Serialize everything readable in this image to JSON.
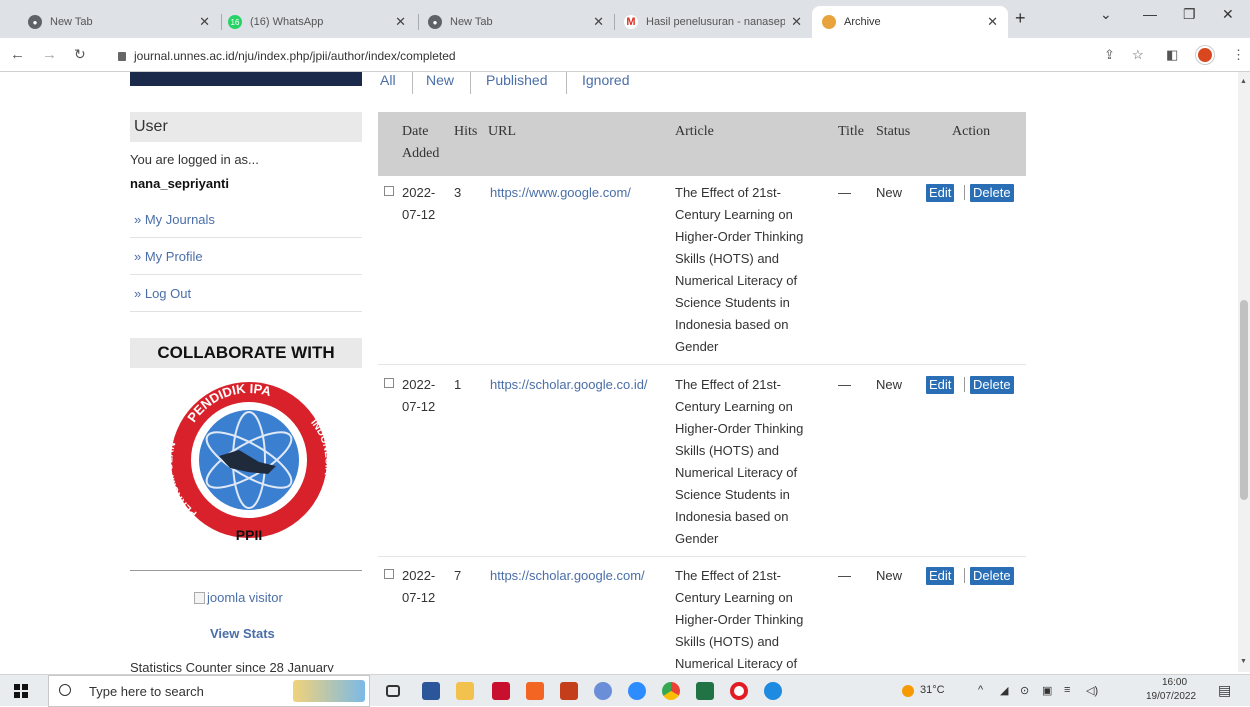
{
  "browser": {
    "tabs": [
      {
        "title": "New Tab",
        "color": "#5f6368"
      },
      {
        "title": "(16) WhatsApp",
        "color": "#25d366",
        "badge": "16"
      },
      {
        "title": "New Tab",
        "color": "#5f6368"
      },
      {
        "title": "Hasil penelusuran - nanasep",
        "color": "#d93025",
        "badge": "M"
      },
      {
        "title": "Archive",
        "color": "#e8a33d"
      }
    ],
    "url": "journal.unnes.ac.id/nju/index.php/jpii/author/index/completed"
  },
  "sidebar": {
    "user_title": "User",
    "logged_in_as": "You are logged in as...",
    "username": "nana_sepriyanti",
    "links": [
      "» My Journals",
      "» My Profile",
      "» Log Out"
    ],
    "collab_title": "COLLABORATE WITH",
    "logo_top_text": "PENDIDIK IPA",
    "logo_left_text": "PERKUMPULAN",
    "logo_right_text": "INDONESIA",
    "logo_bottom_text": "PPII",
    "visitor_img_alt": "joomla visitor",
    "view_stats": "View Stats",
    "counter_text": "Statistics Counter since 28 January"
  },
  "filters": {
    "items": [
      "All",
      "New",
      "Published",
      "Ignored"
    ]
  },
  "table": {
    "headers": {
      "date_line1": "Date",
      "date_line2": "Added",
      "hits": "Hits",
      "url": "URL",
      "article": "Article",
      "title": "Title",
      "status": "Status",
      "action": "Action"
    },
    "rows": [
      {
        "date": "2022-07-12",
        "hits": "3",
        "url": "https://www.google.com/",
        "article": "The Effect of 21st-Century Learning on Higher-Order Thinking Skills (HOTS) and Numerical Literacy of Science Students in Indonesia based on Gender",
        "title": "—",
        "status": "New",
        "edit": "Edit",
        "delete": "Delete"
      },
      {
        "date": "2022-07-12",
        "hits": "1",
        "url": "https://scholar.google.co.id/",
        "article": "The Effect of 21st-Century Learning on Higher-Order Thinking Skills (HOTS) and Numerical Literacy of Science Students in Indonesia based on Gender",
        "title": "—",
        "status": "New",
        "edit": "Edit",
        "delete": "Delete"
      },
      {
        "date": "2022-07-12",
        "hits": "7",
        "url": "https://scholar.google.com/",
        "article": "The Effect of 21st-Century Learning on Higher-Order Thinking Skills (HOTS) and Numerical Literacy of",
        "title": "—",
        "status": "New",
        "edit": "Edit",
        "delete": "Delete"
      }
    ]
  },
  "taskbar": {
    "search_placeholder": "Type here to search",
    "weather": "31°C",
    "time": "16:00",
    "date": "19/07/2022"
  }
}
